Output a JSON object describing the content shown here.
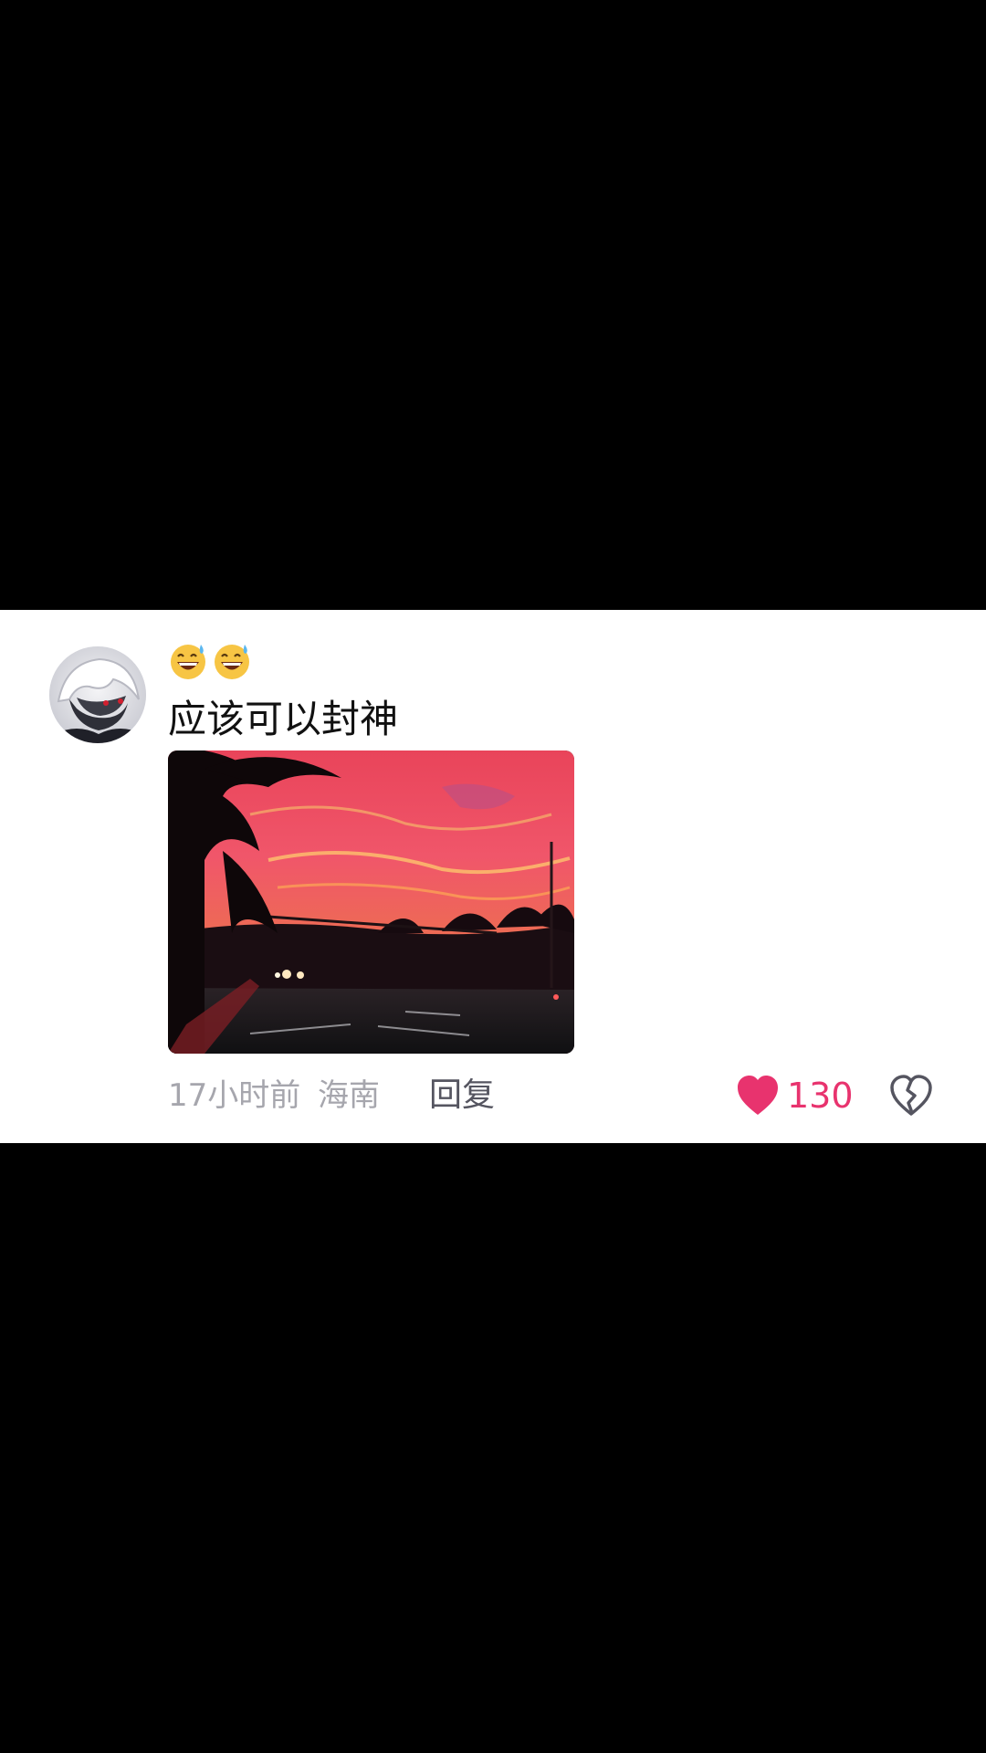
{
  "comment": {
    "emoji": [
      "😅",
      "😅"
    ],
    "text": "应该可以封神",
    "time": "17小时前",
    "location": "海南",
    "reply_label": "回复",
    "like_count": "130",
    "like_color": "#e8336e"
  },
  "icons": {
    "like": "heart-icon",
    "dislike": "broken-heart-icon"
  }
}
